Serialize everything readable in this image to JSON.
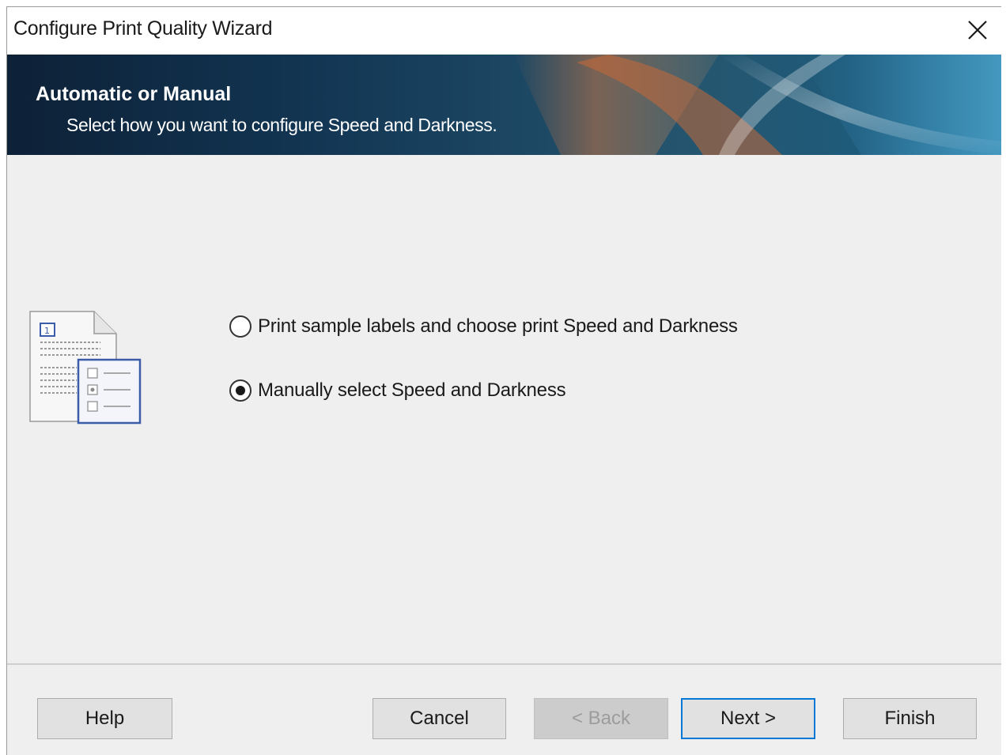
{
  "window": {
    "title": "Configure Print Quality Wizard"
  },
  "banner": {
    "title": "Automatic or Manual",
    "subtitle": "Select how you want to configure Speed and Darkness."
  },
  "options": [
    {
      "label": "Print sample labels and choose print Speed and Darkness",
      "selected": false
    },
    {
      "label": "Manually select Speed and Darkness",
      "selected": true
    }
  ],
  "buttons": {
    "help": "Help",
    "cancel": "Cancel",
    "back": "< Back",
    "next": "Next >",
    "finish": "Finish"
  },
  "icons": {
    "close": "close-icon",
    "wizard": "document-options-icon"
  },
  "colors": {
    "focus_border": "#0078d7",
    "banner_dark": "#0d2137",
    "banner_accent": "#d7703a"
  }
}
